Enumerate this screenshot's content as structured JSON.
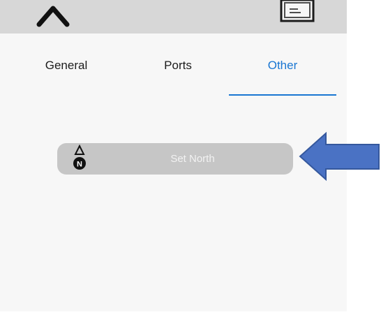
{
  "icons": {
    "collapse": "chevron-up-icon",
    "card": "card-icon",
    "north": "north-compass-icon",
    "annotation": "arrow-left-icon"
  },
  "tabs": [
    {
      "label": "General",
      "selected": false
    },
    {
      "label": "Ports",
      "selected": false
    },
    {
      "label": "Other",
      "selected": true
    }
  ],
  "button": {
    "label": "Set North",
    "north_icon_letter": "N"
  },
  "colors": {
    "accent": "#1976d2",
    "arrow": "#4a72c4",
    "button_bg": "#c6c6c6"
  }
}
